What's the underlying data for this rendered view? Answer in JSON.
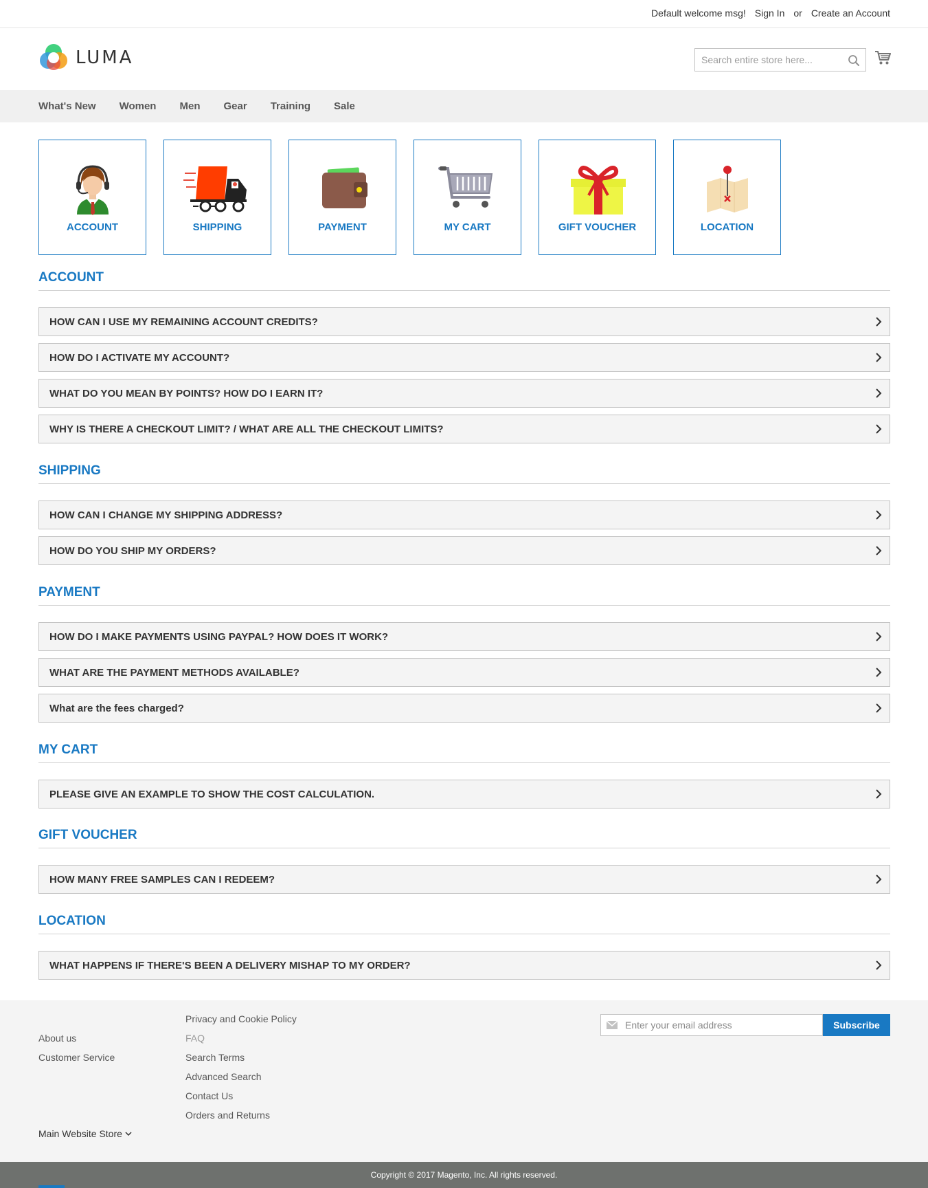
{
  "topbar": {
    "welcome": "Default welcome msg!",
    "sign_in": "Sign In",
    "or": "or",
    "create_account": "Create an Account"
  },
  "header": {
    "logo_text": "LUMA",
    "search_placeholder": "Search entire store here..."
  },
  "nav": {
    "items": [
      "What's New",
      "Women",
      "Men",
      "Gear",
      "Training",
      "Sale"
    ]
  },
  "categories": [
    {
      "label": "ACCOUNT",
      "icon": "customer-service-icon"
    },
    {
      "label": "SHIPPING",
      "icon": "delivery-truck-icon"
    },
    {
      "label": "PAYMENT",
      "icon": "wallet-icon"
    },
    {
      "label": "MY CART",
      "icon": "shopping-cart-icon"
    },
    {
      "label": "GIFT VOUCHER",
      "icon": "gift-icon"
    },
    {
      "label": "LOCATION",
      "icon": "map-pin-icon"
    }
  ],
  "faq": [
    {
      "title": "ACCOUNT",
      "questions": [
        "HOW CAN I USE MY REMAINING ACCOUNT CREDITS?",
        "HOW DO I ACTIVATE MY ACCOUNT?",
        "WHAT DO YOU MEAN BY POINTS? HOW DO I EARN IT?",
        "WHY IS THERE A CHECKOUT LIMIT? / WHAT ARE ALL THE CHECKOUT LIMITS?"
      ]
    },
    {
      "title": "SHIPPING",
      "questions": [
        "HOW CAN I CHANGE MY SHIPPING ADDRESS?",
        "HOW DO YOU SHIP MY ORDERS?"
      ]
    },
    {
      "title": "PAYMENT",
      "questions": [
        "HOW DO I MAKE PAYMENTS USING PAYPAL? HOW DOES IT WORK?",
        "WHAT ARE THE PAYMENT METHODS AVAILABLE?",
        "What are the fees charged?"
      ]
    },
    {
      "title": "MY CART",
      "questions": [
        "PLEASE GIVE AN EXAMPLE TO SHOW THE COST CALCULATION."
      ]
    },
    {
      "title": "GIFT VOUCHER",
      "questions": [
        "HOW MANY FREE SAMPLES CAN I REDEEM?"
      ]
    },
    {
      "title": "LOCATION",
      "questions": [
        "WHAT HAPPENS IF THERE'S BEEN A DELIVERY MISHAP TO MY ORDER?"
      ]
    }
  ],
  "footer": {
    "col1": [
      "About us",
      "Customer Service"
    ],
    "col2": [
      "Privacy and Cookie Policy",
      "FAQ",
      "Search Terms",
      "Advanced Search",
      "Contact Us",
      "Orders and Returns"
    ],
    "current_link": "FAQ",
    "store_switcher": "Main Website Store",
    "newsletter_placeholder": "Enter your email address",
    "subscribe_label": "Subscribe",
    "copyright": "Copyright © 2017 Magento, Inc. All rights reserved."
  },
  "colors": {
    "accent": "#1979c3",
    "nav_bg": "#f0f0f0",
    "footer_bg": "#f4f4f4",
    "copyright_bg": "#6e716e"
  }
}
